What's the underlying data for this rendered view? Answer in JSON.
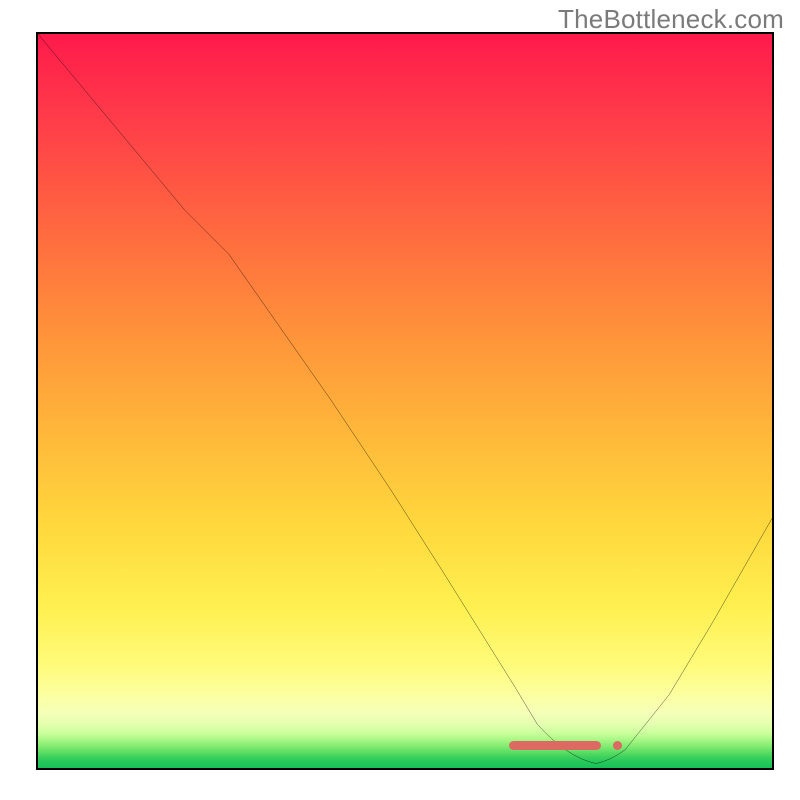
{
  "watermark": "TheBottleneck.com",
  "chart_data": {
    "type": "line",
    "title": "",
    "xlabel": "",
    "ylabel": "",
    "xlim": [
      0,
      100
    ],
    "ylim": [
      0,
      100
    ],
    "grid": false,
    "legend": false,
    "series": [
      {
        "name": "bottleneck-curve",
        "x": [
          0,
          10,
          20,
          26,
          33,
          40,
          48,
          55,
          60,
          65,
          68,
          72,
          76,
          80,
          86,
          92,
          100
        ],
        "y": [
          100,
          88,
          76,
          70,
          60,
          50,
          38,
          27,
          19,
          11,
          6,
          2,
          0.5,
          2,
          10,
          20,
          34
        ],
        "color": "#000000"
      }
    ],
    "background_gradient": {
      "orientation": "vertical",
      "stops": [
        {
          "pos": 0.0,
          "color": "#ff1a4b"
        },
        {
          "pos": 0.5,
          "color": "#ffb93a"
        },
        {
          "pos": 0.86,
          "color": "#fffb7a"
        },
        {
          "pos": 1.0,
          "color": "#17c058"
        }
      ]
    },
    "annotations": [
      {
        "name": "optimal-range-band",
        "shape": "rounded-bar",
        "x_start": 65,
        "x_end": 76,
        "y": 2.5,
        "color": "#dc6a62"
      },
      {
        "name": "optimal-range-dot",
        "shape": "dot",
        "x": 78.5,
        "y": 2.5,
        "color": "#dc6a62"
      }
    ]
  }
}
